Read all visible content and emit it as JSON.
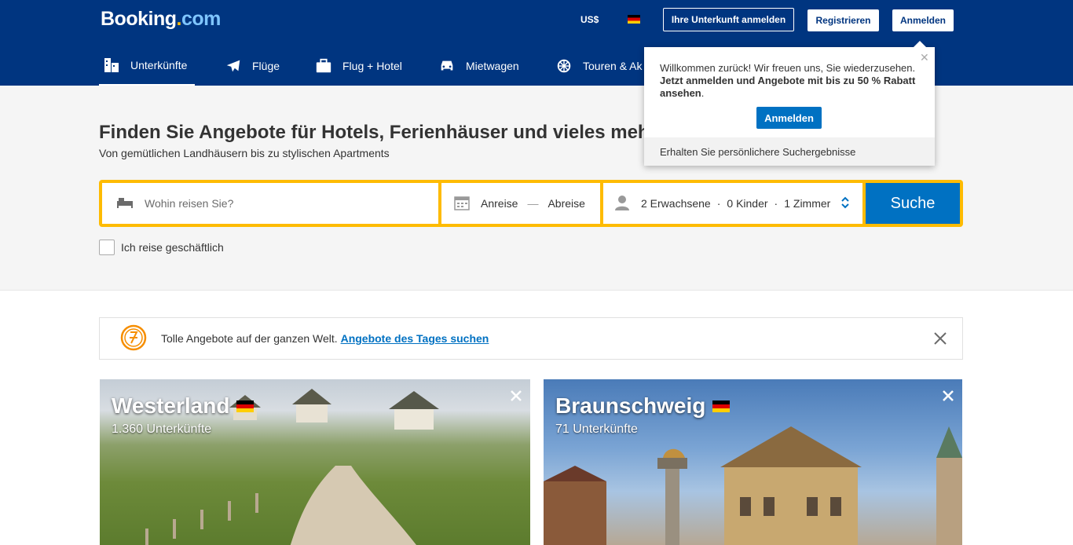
{
  "header": {
    "logo_main": "Booking",
    "logo_dot": ".",
    "logo_tld": "com",
    "currency": "US$",
    "language_flag": "flag-germany",
    "list_property_label": "Ihre Unterkunft anmelden",
    "register_label": "Registrieren",
    "login_label": "Anmelden"
  },
  "nav": {
    "items": [
      {
        "label": "Unterkünfte",
        "icon": "bed-icon",
        "active": true
      },
      {
        "label": "Flüge",
        "icon": "plane-icon"
      },
      {
        "label": "Flug + Hotel",
        "icon": "suitcase-icon"
      },
      {
        "label": "Mietwagen",
        "icon": "car-icon"
      },
      {
        "label": "Touren & Ak",
        "icon": "ferris-wheel-icon"
      }
    ]
  },
  "hero": {
    "title": "Finden Sie Angebote für Hotels, Ferienhäuser und vieles mehr",
    "subtitle": "Von gemütlichen Landhäusern bis zu stylischen Apartments"
  },
  "search": {
    "destination_placeholder": "Wohin reisen Sie?",
    "checkin": "Anreise",
    "checkout": "Abreise",
    "adults": "2 Erwachsene",
    "children": "0 Kinder",
    "rooms": "1 Zimmer",
    "guest_separator": "·",
    "date_separator": "—",
    "search_label": "Suche",
    "business_label": "Ich reise geschäftlich"
  },
  "popover": {
    "line1": "Willkommen zurück! Wir freuen uns, Sie wiederzusehen.",
    "line2_bold": "Jetzt anmelden und Angebote mit bis zu 50 % Rabatt ansehen",
    "line2_end": ".",
    "button_label": "Anmelden",
    "footer": "Erhalten Sie persönlichere Suchergebnisse",
    "close_glyph": "✕"
  },
  "deals": {
    "text": "Tolle Angebote auf der ganzen Welt.",
    "link": "Angebote des Tages suchen"
  },
  "cards": [
    {
      "name": "Westerland",
      "count": "1.360 Unterkünfte"
    },
    {
      "name": "Braunschweig",
      "count": "71 Unterkünfte"
    }
  ],
  "colors": {
    "brand_blue": "#003580",
    "action_blue": "#0071c2",
    "search_yellow": "#febb02"
  }
}
